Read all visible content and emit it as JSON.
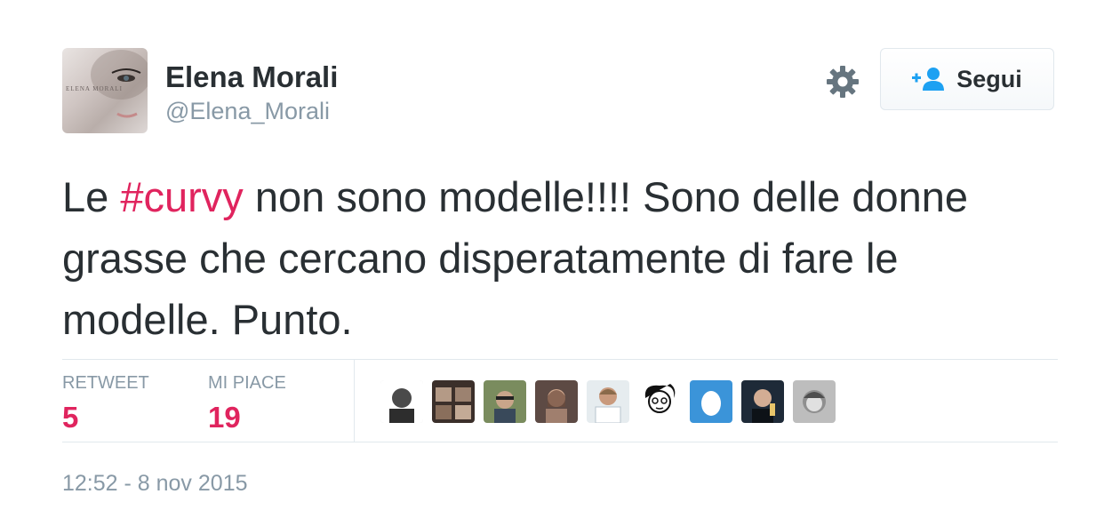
{
  "user": {
    "display_name": "Elena Morali",
    "handle": "@Elena_Morali",
    "avatar_text": "ELENA MORALI"
  },
  "header": {
    "settings_icon": "gear-icon",
    "follow_icon": "add-user-icon",
    "follow_label": "Segui"
  },
  "tweet": {
    "text_before": "Le ",
    "hashtag": "#curvy",
    "text_after": " non sono modelle!!!! Sono delle donne grasse che cercano disperatamente di fare le modelle. Punto."
  },
  "stats": {
    "retweets_label": "RETWEET",
    "retweets_count": "5",
    "likes_label": "MI PIACE",
    "likes_count": "19"
  },
  "likers": [
    {
      "name": "liker-avatar-1"
    },
    {
      "name": "liker-avatar-2"
    },
    {
      "name": "liker-avatar-3"
    },
    {
      "name": "liker-avatar-4"
    },
    {
      "name": "liker-avatar-5"
    },
    {
      "name": "liker-avatar-6"
    },
    {
      "name": "liker-avatar-7"
    },
    {
      "name": "liker-avatar-8"
    },
    {
      "name": "liker-avatar-9"
    }
  ],
  "timestamp": "12:52 - 8 nov 2015",
  "colors": {
    "text": "#292f33",
    "muted": "#8899a6",
    "hashtag": "#e0245e",
    "stat_value": "#e0245e",
    "follow_icon": "#1da1f2",
    "border": "#e1e8ed"
  }
}
